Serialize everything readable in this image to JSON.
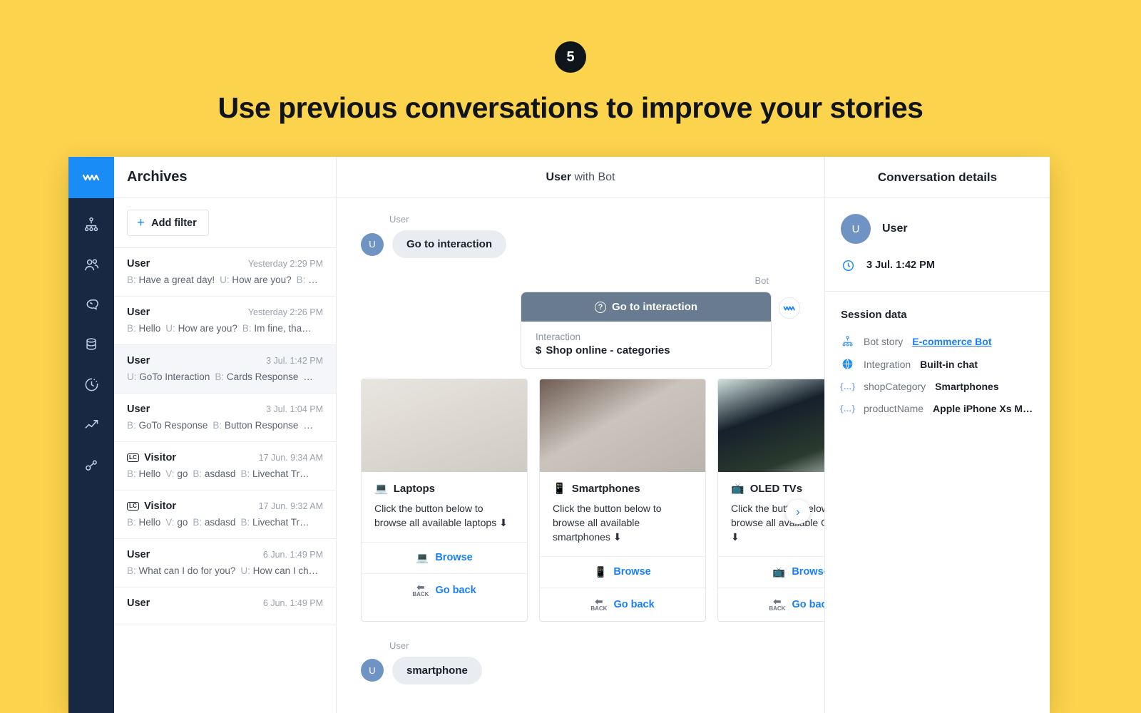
{
  "promo": {
    "step_number": "5",
    "title": "Use previous conversations to improve your stories",
    "background_color": "#fcd34c"
  },
  "rail": {
    "logo_icon": "chatbot-zigzag-logo",
    "items": [
      {
        "name": "stories",
        "icon": "org-chart-icon"
      },
      {
        "name": "users",
        "icon": "users-icon"
      },
      {
        "name": "ai-brain",
        "icon": "brain-icon"
      },
      {
        "name": "knowledge-base",
        "icon": "database-icon"
      },
      {
        "name": "archives",
        "icon": "clock-history-icon"
      },
      {
        "name": "analytics",
        "icon": "trending-up-icon"
      },
      {
        "name": "settings",
        "icon": "nodes-icon"
      }
    ]
  },
  "archives": {
    "title": "Archives",
    "add_filter_label": "Add filter",
    "add_filter_icon": "plus-icon",
    "conversations": [
      {
        "who": "User",
        "badge": "",
        "time": "Yesterday 2:29 PM",
        "active": false,
        "snippet": [
          {
            "prefix": "B:",
            "text": "Have a great day!"
          },
          {
            "prefix": "U:",
            "text": "How are you?"
          },
          {
            "prefix": "B:",
            "text": "…"
          }
        ]
      },
      {
        "who": "User",
        "badge": "",
        "time": "Yesterday 2:26 PM",
        "active": false,
        "snippet": [
          {
            "prefix": "B:",
            "text": "Hello"
          },
          {
            "prefix": "U:",
            "text": "How are you?"
          },
          {
            "prefix": "B:",
            "text": "Im fine, tha…"
          }
        ]
      },
      {
        "who": "User",
        "badge": "",
        "time": "3 Jul. 1:42 PM",
        "active": true,
        "snippet": [
          {
            "prefix": "U:",
            "text": "GoTo Interaction"
          },
          {
            "prefix": "B:",
            "text": "Cards Response"
          },
          {
            "prefix": "",
            "text": "…"
          }
        ]
      },
      {
        "who": "User",
        "badge": "",
        "time": "3 Jul. 1:04 PM",
        "active": false,
        "snippet": [
          {
            "prefix": "B:",
            "text": "GoTo Response"
          },
          {
            "prefix": "B:",
            "text": "Button Response"
          },
          {
            "prefix": "",
            "text": "…"
          }
        ]
      },
      {
        "who": "Visitor",
        "badge": "LC",
        "time": "17 Jun. 9:34 AM",
        "active": false,
        "snippet": [
          {
            "prefix": "B:",
            "text": "Hello"
          },
          {
            "prefix": "V:",
            "text": "go"
          },
          {
            "prefix": "B:",
            "text": "asdasd"
          },
          {
            "prefix": "B:",
            "text": "Livechat Tr…"
          }
        ]
      },
      {
        "who": "Visitor",
        "badge": "LC",
        "time": "17 Jun. 9:32 AM",
        "active": false,
        "snippet": [
          {
            "prefix": "B:",
            "text": "Hello"
          },
          {
            "prefix": "V:",
            "text": "go"
          },
          {
            "prefix": "B:",
            "text": "asdasd"
          },
          {
            "prefix": "B:",
            "text": "Livechat Tr…"
          }
        ]
      },
      {
        "who": "User",
        "badge": "",
        "time": "6 Jun. 1:49 PM",
        "active": false,
        "snippet": [
          {
            "prefix": "B:",
            "text": "What can I do for you?"
          },
          {
            "prefix": "U:",
            "text": "How can I ch…"
          }
        ]
      },
      {
        "who": "User",
        "badge": "",
        "time": "6 Jun. 1:49 PM",
        "active": false,
        "snippet": []
      }
    ]
  },
  "conversation": {
    "header_user": "User",
    "header_rest": " with Bot",
    "messages": {
      "first_user": {
        "label": "User",
        "avatar_initial": "U",
        "text": "Go to interaction"
      },
      "bot": {
        "label": "Bot",
        "card_title": "Go to interaction",
        "card_title_icon": "question-circle-icon",
        "field_label": "Interaction",
        "field_value": "Shop online - categories",
        "field_value_icon": "dollar-icon",
        "avatar_icon": "chatbot-zigzag-logo"
      },
      "last_user": {
        "label": "User",
        "avatar_initial": "U",
        "text": "smartphone"
      }
    },
    "carousel": {
      "next_icon": "chevron-right-icon",
      "cards": [
        {
          "title": "Laptops",
          "title_icon": "laptop-emoji",
          "description": "Click the button below to browse all available laptops ⬇",
          "buttons": [
            {
              "label": "Browse",
              "icon": "laptop-emoji"
            },
            {
              "label": "Go back",
              "icon": "back-arrow-emoji"
            }
          ]
        },
        {
          "title": "Smartphones",
          "title_icon": "mobile-phone-emoji",
          "description": "Click the button below to browse all available smartphones ⬇",
          "buttons": [
            {
              "label": "Browse",
              "icon": "mobile-phone-emoji"
            },
            {
              "label": "Go back",
              "icon": "back-arrow-emoji"
            }
          ]
        },
        {
          "title": "OLED TVs",
          "title_icon": "television-emoji",
          "description": "Click the button below to browse all available OLED TVs ⬇",
          "buttons": [
            {
              "label": "Browse",
              "icon": "television-emoji"
            },
            {
              "label": "Go back",
              "icon": "back-arrow-emoji"
            }
          ]
        }
      ]
    }
  },
  "details": {
    "title": "Conversation details",
    "user_name": "User",
    "user_initial": "U",
    "timestamp": "3 Jul. 1:42 PM",
    "timestamp_icon": "clock-icon",
    "session_title": "Session data",
    "session_rows": [
      {
        "icon": "org-chart-icon",
        "key": "Bot story",
        "value": "E-commerce Bot",
        "is_link": true
      },
      {
        "icon": "globe-icon",
        "key": "Integration",
        "value": "Built-in chat",
        "is_link": false
      },
      {
        "icon": "braces-icon",
        "key": "shopCategory",
        "value": "Smartphones",
        "is_link": false
      },
      {
        "icon": "braces-icon",
        "key": "productName",
        "value": "Apple iPhone Xs Max …",
        "is_link": false
      }
    ]
  },
  "colors": {
    "accent_blue": "#1a8cf5",
    "rail_navy": "#182742",
    "bot_card_header": "#687b91",
    "avatar_blue": "#6f93c2",
    "promo_yellow": "#fcd34c"
  }
}
